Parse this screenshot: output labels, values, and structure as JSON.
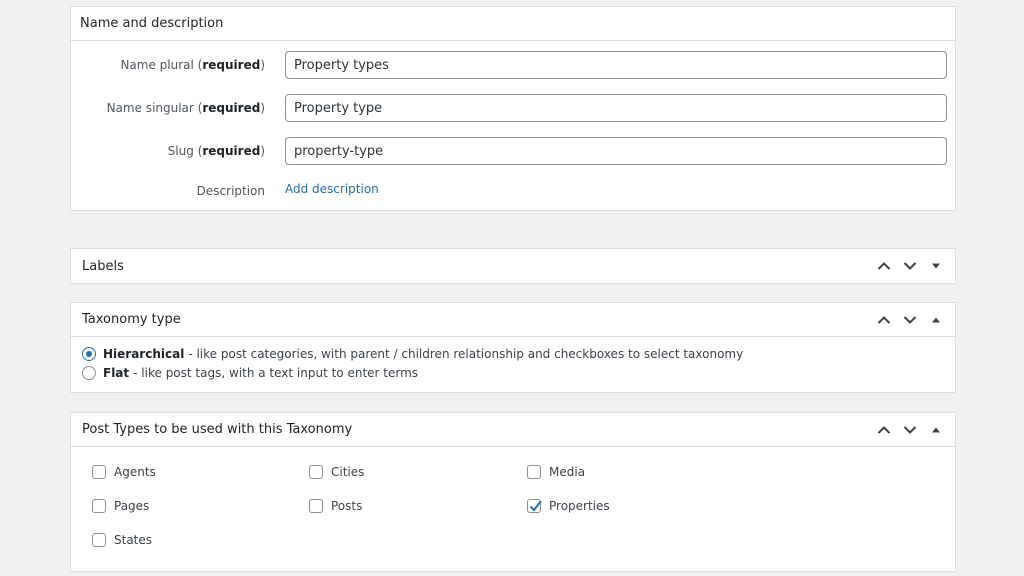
{
  "name_description": {
    "title": "Name and description",
    "fields": [
      {
        "label": "Name plural",
        "required": "required",
        "value": "Property types"
      },
      {
        "label": "Name singular",
        "required": "required",
        "value": "Property type"
      },
      {
        "label": "Slug",
        "required": "required",
        "value": "property-type"
      }
    ],
    "description_label": "Description",
    "description_link": "Add description"
  },
  "labels_panel": {
    "title": "Labels",
    "expanded": false
  },
  "taxonomy_type": {
    "title": "Taxonomy type",
    "expanded": true,
    "options": [
      {
        "name": "Hierarchical",
        "description": " - like post categories, with parent / children relationship and checkboxes to select taxonomy",
        "checked": true
      },
      {
        "name": "Flat",
        "description": " - like post tags, with a text input to enter terms",
        "checked": false
      }
    ]
  },
  "post_types": {
    "title": "Post Types to be used with this Taxonomy",
    "expanded": true,
    "items": [
      {
        "label": "Agents",
        "checked": false
      },
      {
        "label": "Cities",
        "checked": false
      },
      {
        "label": "Media",
        "checked": false
      },
      {
        "label": "Pages",
        "checked": false
      },
      {
        "label": "Posts",
        "checked": false
      },
      {
        "label": "Properties",
        "checked": true
      },
      {
        "label": "States",
        "checked": false
      }
    ]
  },
  "colors": {
    "accent": "#2271b1",
    "background": "#f0f0f1",
    "border": "#dcdcde"
  },
  "icons": {
    "move_up": "chevron-up-icon",
    "move_down": "chevron-down-icon",
    "toggle_collapsed": "triangle-down-icon",
    "toggle_expanded": "triangle-up-icon"
  }
}
